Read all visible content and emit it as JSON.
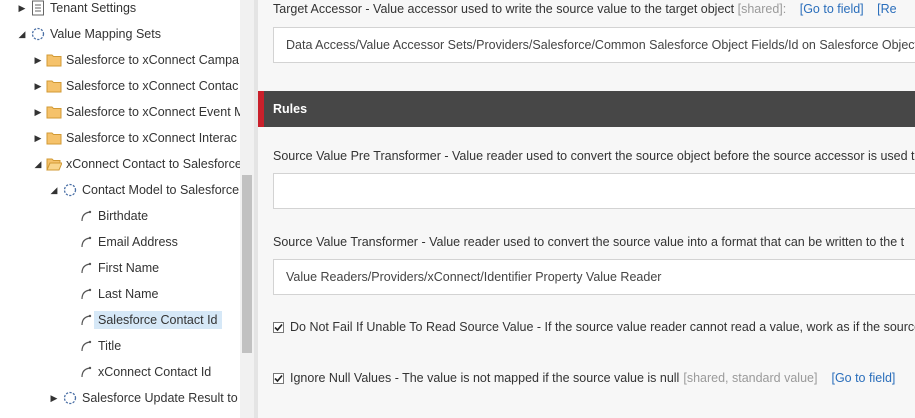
{
  "tree": {
    "items": [
      {
        "label": "Tenant Settings",
        "icon": "settings-page-icon",
        "arrow": "right"
      },
      {
        "label": "Value Mapping Sets",
        "icon": "circle-dashed-icon",
        "arrow": "down"
      },
      {
        "label": "Salesforce to xConnect Campa",
        "icon": "folder-icon",
        "arrow": "right"
      },
      {
        "label": "Salesforce to xConnect Contac",
        "icon": "folder-icon",
        "arrow": "right"
      },
      {
        "label": "Salesforce to xConnect Event M",
        "icon": "folder-icon",
        "arrow": "right"
      },
      {
        "label": "Salesforce to xConnect Interac",
        "icon": "folder-icon",
        "arrow": "right"
      },
      {
        "label": "xConnect Contact to Salesforce",
        "icon": "folder-open-icon",
        "arrow": "down"
      },
      {
        "label": "Contact Model to Salesforce",
        "icon": "circle-dashed-icon",
        "arrow": "down"
      },
      {
        "label": "Birthdate",
        "icon": "mapping-arc-icon",
        "arrow": ""
      },
      {
        "label": "Email Address",
        "icon": "mapping-arc-icon",
        "arrow": ""
      },
      {
        "label": "First Name",
        "icon": "mapping-arc-icon",
        "arrow": ""
      },
      {
        "label": "Last Name",
        "icon": "mapping-arc-icon",
        "arrow": ""
      },
      {
        "label": "Salesforce Contact Id",
        "icon": "mapping-arc-icon",
        "arrow": "",
        "selected": true
      },
      {
        "label": "Title",
        "icon": "mapping-arc-icon",
        "arrow": ""
      },
      {
        "label": "xConnect Contact Id",
        "icon": "mapping-arc-icon",
        "arrow": ""
      },
      {
        "label": "Salesforce Update Result to",
        "icon": "circle-dashed-icon",
        "arrow": "right"
      }
    ]
  },
  "target_accessor": {
    "label": "Target Accessor - Value accessor used to write the source value to the target object",
    "meta": "[shared]:",
    "link1": "[Go to field]",
    "link2": "[Re",
    "value": "Data Access/Value Accessor Sets/Providers/Salesforce/Common Salesforce Object Fields/Id on Salesforce Object"
  },
  "rules": {
    "header": "Rules",
    "pre_transformer": {
      "label": "Source Value Pre Transformer - Value reader used to convert the source object before the source accessor is used t",
      "value": ""
    },
    "transformer": {
      "label": "Source Value Transformer - Value reader used to convert the source value into a format that can be written to the t",
      "value": "Value Readers/Providers/xConnect/Identifier Property Value Reader"
    },
    "do_not_fail": {
      "label": "Do Not Fail If Unable To Read Source Value - If the source value reader cannot read a value, work as if the source",
      "checked": true
    },
    "ignore_null": {
      "label": "Ignore Null Values - The value is not mapped if the source value is null",
      "meta": "[shared, standard value]",
      "link": "[Go to field]",
      "checked": true
    }
  },
  "colors": {
    "accent_red": "#c9202b",
    "header_bg": "#474747",
    "link": "#2a6ebb",
    "selected_bg": "#d6e8f7"
  }
}
